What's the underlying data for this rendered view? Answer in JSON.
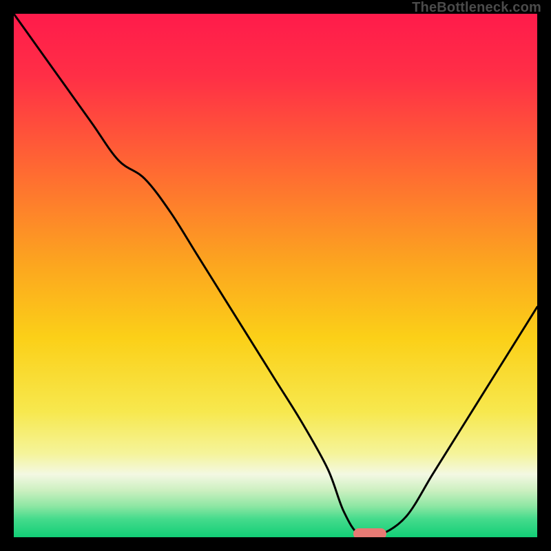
{
  "watermark": "TheBottleneck.com",
  "chart_data": {
    "type": "line",
    "title": "",
    "xlabel": "",
    "ylabel": "",
    "xlim": [
      0,
      100
    ],
    "ylim": [
      0,
      100
    ],
    "series": [
      {
        "name": "bottleneck-curve",
        "x": [
          0,
          5,
          10,
          15,
          20,
          25,
          30,
          35,
          40,
          45,
          50,
          55,
          60,
          63,
          66,
          70,
          75,
          80,
          85,
          90,
          95,
          100
        ],
        "y": [
          100,
          93,
          86,
          79,
          72,
          68.5,
          62,
          54,
          46,
          38,
          30,
          22,
          13,
          5,
          0.5,
          0.5,
          4,
          12,
          20,
          28,
          36,
          44
        ]
      }
    ],
    "marker": {
      "x": 68,
      "y": 0.6
    },
    "gradient_stops": [
      {
        "pct": 0,
        "color": "#ff1b4b"
      },
      {
        "pct": 12,
        "color": "#ff2f46"
      },
      {
        "pct": 30,
        "color": "#ff6a32"
      },
      {
        "pct": 48,
        "color": "#fca61f"
      },
      {
        "pct": 62,
        "color": "#fbd018"
      },
      {
        "pct": 76,
        "color": "#f7e84e"
      },
      {
        "pct": 84,
        "color": "#f5f49a"
      },
      {
        "pct": 88,
        "color": "#f3f8e3"
      },
      {
        "pct": 91,
        "color": "#cdf0c1"
      },
      {
        "pct": 94,
        "color": "#8fe7a4"
      },
      {
        "pct": 96.5,
        "color": "#45db8c"
      },
      {
        "pct": 100,
        "color": "#12ce76"
      }
    ]
  }
}
